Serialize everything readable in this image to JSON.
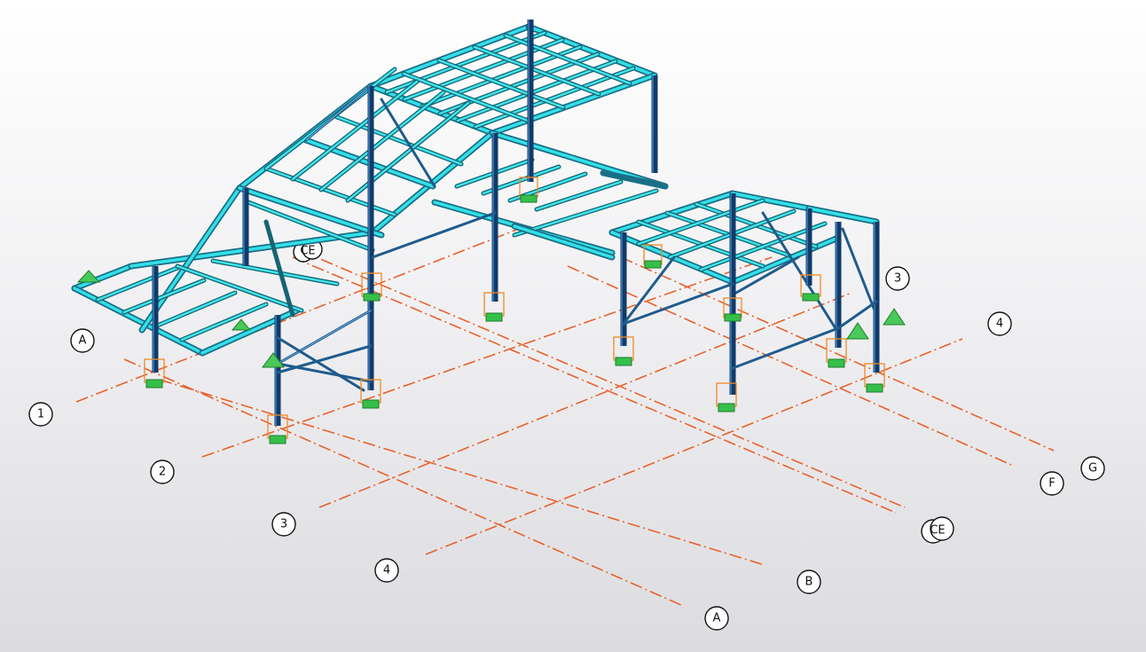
{
  "viewport": {
    "background": "#e6e6ea",
    "grid_color": "#e8622c",
    "member_primary_color": "#33e0e8",
    "column_color": "#123a68",
    "support_color": "#35c04a",
    "base_box_color": "#f08a24"
  },
  "grid_bubbles": {
    "a_front": "A",
    "a_left": "A",
    "b_front": "B",
    "ce_front": "CE",
    "f_right": "F",
    "g_right": "G",
    "one_left": "1",
    "two_left": "2",
    "three_left": "3",
    "four_left": "4",
    "three_right": "3",
    "four_right": "4",
    "ce_mid": "CE"
  }
}
